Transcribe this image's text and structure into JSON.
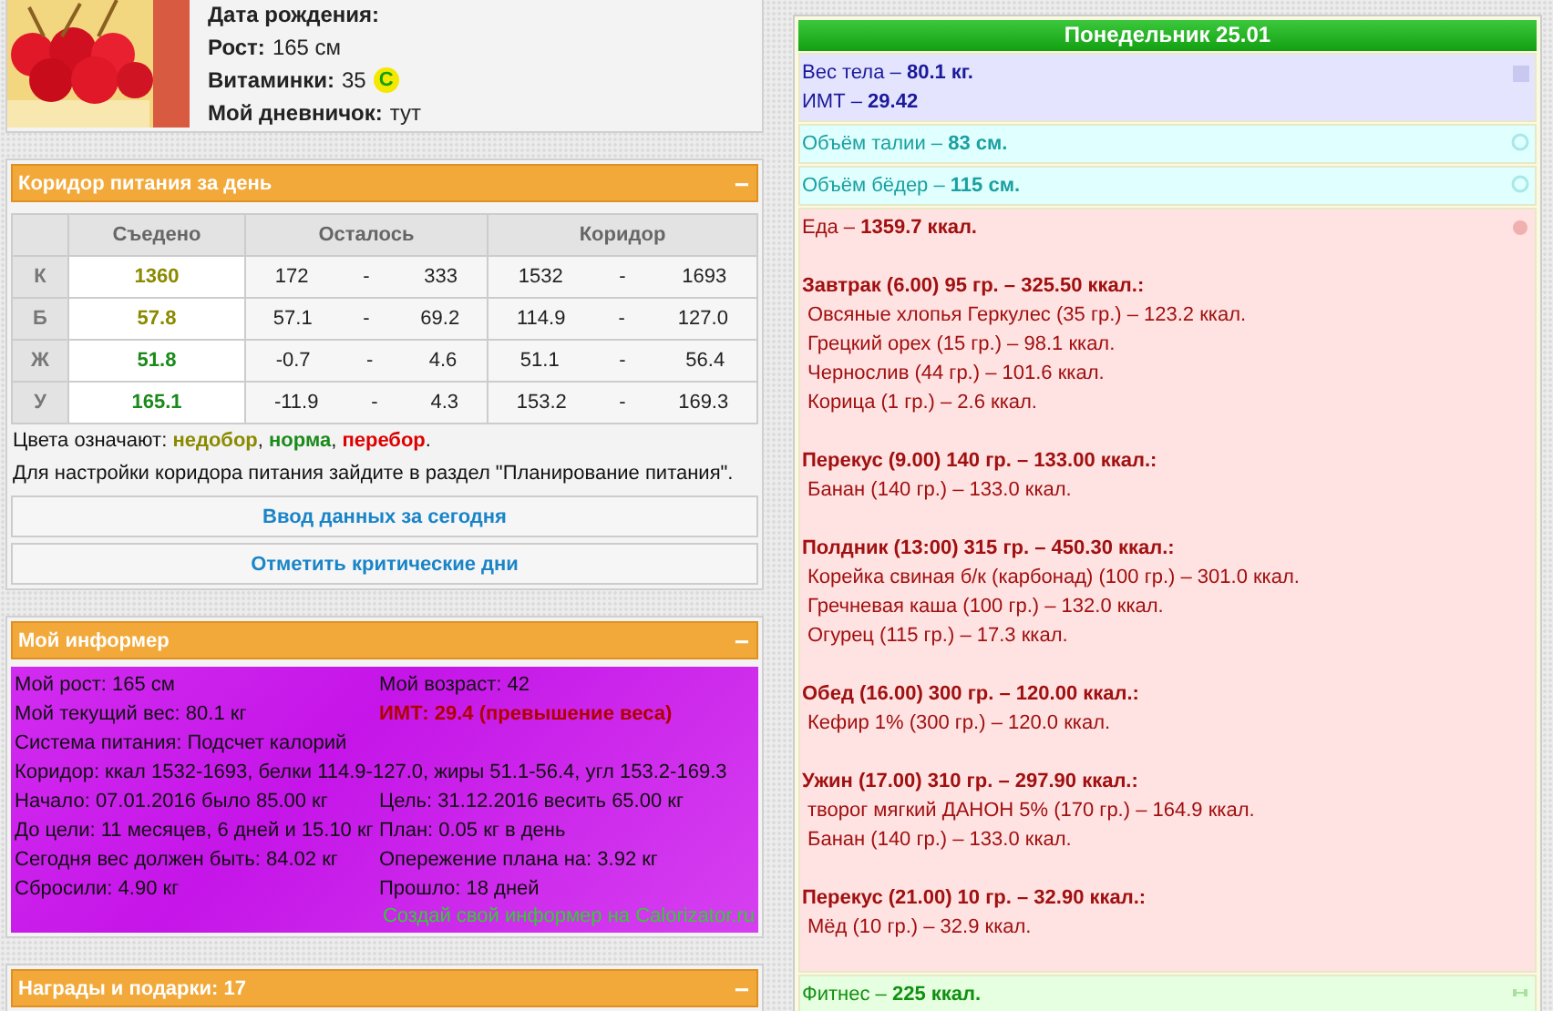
{
  "profile": {
    "fields": [
      {
        "label": "Дата рождения:"
      },
      {
        "label": "Рост:",
        "value": "165 см"
      },
      {
        "label": "Витаминки:",
        "value": "35",
        "badge": "C"
      },
      {
        "label": "Мой дневничок:",
        "value": "тут"
      }
    ]
  },
  "corridor": {
    "title": "Коридор питания за день",
    "collapse": "−",
    "columns": [
      "Съедено",
      "Осталось",
      "Коридор"
    ],
    "rows": [
      {
        "label": "К",
        "eaten": "1360",
        "color": "#8a8a00",
        "left_from": "172",
        "left_to": "333",
        "corridor_from": "1532",
        "corridor_to": "1693"
      },
      {
        "label": "Б",
        "eaten": "57.8",
        "color": "#8a8a00",
        "left_from": "57.1",
        "left_to": "69.2",
        "corridor_from": "114.9",
        "corridor_to": "127.0"
      },
      {
        "label": "Ж",
        "eaten": "51.8",
        "color": "#1a8a1a",
        "left_from": "-0.7",
        "left_to": "4.6",
        "corridor_from": "51.1",
        "corridor_to": "56.4"
      },
      {
        "label": "У",
        "eaten": "165.1",
        "color": "#1a8a1a",
        "left_from": "-11.9",
        "left_to": "4.3",
        "corridor_from": "153.2",
        "corridor_to": "169.3"
      }
    ],
    "separator": "-",
    "legend": {
      "label": "Цвета означают:",
      "items": [
        {
          "text": "недобор",
          "color": "#8a8a00"
        },
        {
          "text": "норма",
          "color": "#1a8a1a"
        },
        {
          "text": "перебор",
          "color": "#dd0000"
        }
      ],
      "separator": ",",
      "end": "."
    },
    "note": "Для настройки коридора питания зайдите в раздел \"Планирование питания\".",
    "buttons": [
      "Ввод данных за сегодня",
      "Отметить критические дни"
    ]
  },
  "informer": {
    "title": "Мой информер",
    "collapse": "−",
    "rows": [
      [
        {
          "text": "Мой рост: 165 см",
          "alert": false
        },
        {
          "text": "Мой возраст: 42",
          "alert": false
        }
      ],
      [
        {
          "text": "Мой текущий вес: 80.1 кг",
          "alert": false
        },
        {
          "text": "ИМТ: 29.4 (превышение веса)",
          "alert": true
        }
      ],
      [
        {
          "text": "Система питания: Подсчет калорий",
          "alert": false
        }
      ],
      [
        {
          "text": "Коридор: ккал 1532-1693, белки 114.9-127.0, жиры 51.1-56.4, угл 153.2-169.3",
          "alert": false
        }
      ],
      [
        {
          "text": "Начало: 07.01.2016 было 85.00 кг",
          "alert": false
        },
        {
          "text": "Цель: 31.12.2016 весить 65.00 кг",
          "alert": false
        }
      ],
      [
        {
          "text": "До цели: 11 месяцев, 6 дней и 15.10 кг",
          "alert": false
        },
        {
          "text": "План: 0.05 кг в день",
          "alert": false
        }
      ],
      [
        {
          "text": "Сегодня вес должен быть: 84.02 кг",
          "alert": false
        },
        {
          "text": "Опережение плана на: 3.92 кг",
          "alert": false
        }
      ],
      [
        {
          "text": "Сбросили: 4.90 кг",
          "alert": false
        },
        {
          "text": "Прошло: 18 дней",
          "alert": false
        }
      ]
    ],
    "link": "Создай свой информер на Calorizator.ru"
  },
  "awards": {
    "title": "Награды и подарки: 17",
    "collapse": "−"
  },
  "day": {
    "title": "Понедельник  25.01",
    "sections": [
      {
        "kind": "weight",
        "lines": [
          "Вес тела – **80.1 кг.**",
          "ИМТ  – **29.42**"
        ]
      },
      {
        "kind": "measure",
        "lines": [
          "Объём талии – **83 см.**"
        ]
      },
      {
        "kind": "measure",
        "lines": [
          "Объём бёдер – **115 см.**"
        ]
      },
      {
        "kind": "food",
        "lines": [
          "Еда – **1359.7 ккал.**"
        ],
        "meals": [
          {
            "title": "Завтрак (6.00) 95 гр. – 325.50 ккал.:",
            "items": [
              "Овсяные хлопья Геркулес (35 гр.) – 123.2 ккал.",
              "Грецкий орех (15 гр.) – 98.1 ккал.",
              "Чернослив (44 гр.) – 101.6 ккал.",
              "Корица (1 гр.) – 2.6 ккал."
            ]
          },
          {
            "title": "Перекус (9.00) 140 гр. – 133.00 ккал.:",
            "items": [
              "Банан (140 гр.) – 133.0 ккал."
            ]
          },
          {
            "title": "Полдник (13:00) 315 гр. – 450.30 ккал.:",
            "items": [
              "Корейка свиная б/к (карбонад) (100 гр.) – 301.0 ккал.",
              "Гречневая каша (100 гр.) – 132.0 ккал.",
              "Огурец (115 гр.) – 17.3 ккал."
            ]
          },
          {
            "title": "Обед (16.00) 300 гр. – 120.00 ккал.:",
            "items": [
              "Кефир 1% (300 гр.) – 120.0 ккал."
            ]
          },
          {
            "title": "Ужин (17.00) 310 гр. – 297.90 ккал.:",
            "items": [
              "творог мягкий ДАНОН 5% (170 гр.) – 164.9 ккал.",
              "Банан (140 гр.) – 133.0 ккал."
            ]
          },
          {
            "title": "Перекус (21.00) 10 гр. – 32.90 ккал.:",
            "items": [
              "Мёд (10 гр.) – 32.9 ккал."
            ]
          }
        ]
      },
      {
        "kind": "fitness",
        "lines": [
          "Фитнес – **225 ккал.**"
        ]
      }
    ]
  }
}
